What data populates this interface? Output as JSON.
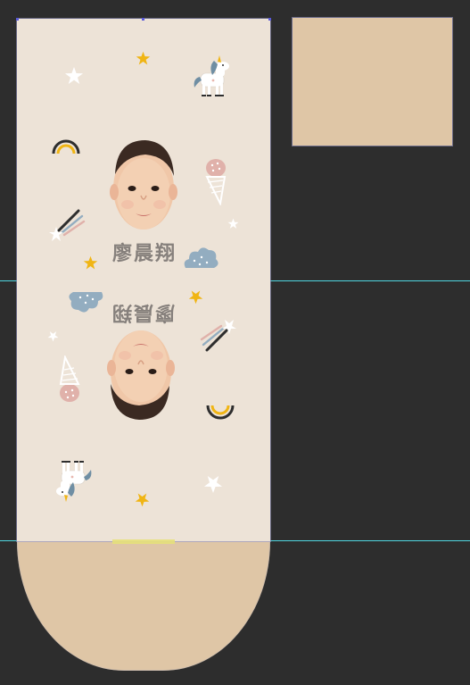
{
  "canvas": {
    "background": "#2d2d2d",
    "guide_color": "#4fd6e0"
  },
  "artboard": {
    "paper_color": "#ede3d7",
    "flap_color": "#dfc6a6",
    "glue_strip_color": "#e6e07a"
  },
  "swatch": {
    "color": "#dfc6a6"
  },
  "design": {
    "name_text": "廖晨翔",
    "name_text_flipped": "廖晨翔",
    "text_color": "#86807c",
    "decorations": [
      "star-icon",
      "unicorn-icon",
      "rainbow-icon",
      "ice-cream-icon",
      "cloud-icon",
      "shooting-star-icon",
      "baby-face-photo"
    ],
    "star_yellow": "#f0b514",
    "cloud_blue": "#93adc0",
    "ice_cream_pink": "#e0b1aa"
  }
}
